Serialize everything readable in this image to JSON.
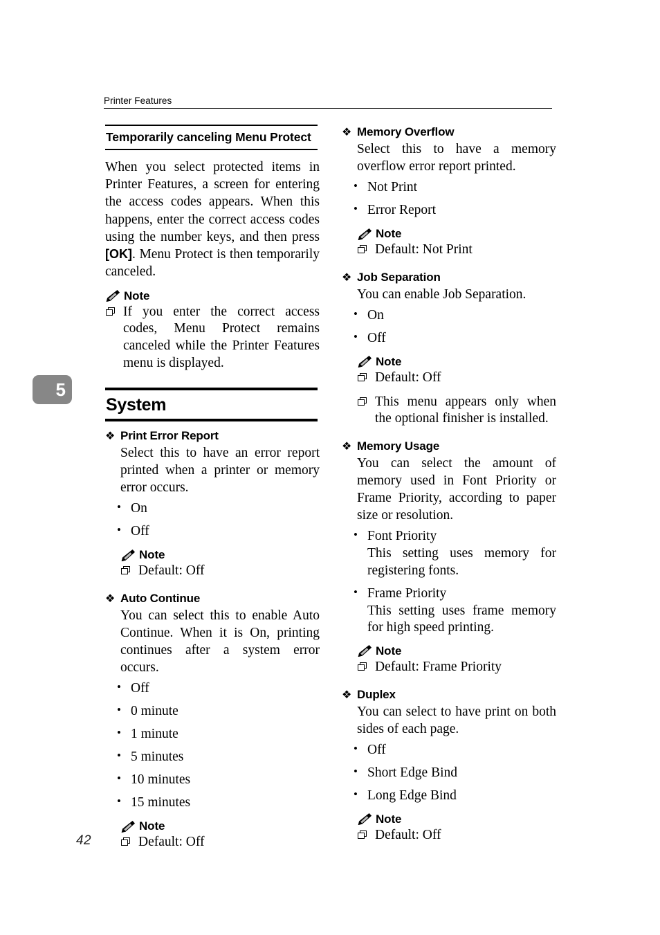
{
  "header": {
    "running_head": "Printer Features"
  },
  "chapter_tab": {
    "number": "5",
    "bg": "#878787",
    "fg": "#ffffff"
  },
  "folio": {
    "page_number": "42"
  },
  "left_column": {
    "subheading": "Temporarily canceling Menu Protect",
    "intro_paragraph": "When you select protected items in Printer Features, a screen for entering the access codes appears. When this happens, enter the correct access codes using the number keys, and then press [OK]. Menu Protect is then temporarily canceled.",
    "intro_paragraph_before_kbd": "When you select protected items in Printer Features, a screen for entering the access codes appears. When this happens, enter the correct access codes using the number keys, and then press ",
    "intro_paragraph_kbd": "[OK]",
    "intro_paragraph_after_kbd": ". Menu Protect is then temporarily canceled.",
    "note_label": "Note",
    "note_items": [
      "If you enter the correct access codes, Menu Protect remains canceled while the Printer Features menu is displayed."
    ],
    "big_heading": "System",
    "sections": [
      {
        "title": "Print Error Report",
        "body": "Select this to have an error report printed when a printer or memory error occurs.",
        "options": [
          "On",
          "Off"
        ],
        "note_label": "Note",
        "note_items": [
          "Default: Off"
        ]
      },
      {
        "title": "Auto Continue",
        "body": "You can select this to enable Auto Continue. When it is On, printing continues after a system error occurs.",
        "options": [
          "Off",
          "0 minute",
          "1 minute",
          "5 minutes",
          "10 minutes",
          "15 minutes"
        ],
        "note_label": "Note",
        "note_items": [
          "Default: Off"
        ]
      }
    ]
  },
  "right_column": {
    "sections": [
      {
        "title": "Memory Overflow",
        "body": "Select this to have a memory overflow error report printed.",
        "options": [
          "Not Print",
          "Error Report"
        ],
        "note_label": "Note",
        "note_items": [
          "Default: Not Print"
        ]
      },
      {
        "title": "Job Separation",
        "body": "You can enable Job Separation.",
        "options": [
          "On",
          "Off"
        ],
        "note_label": "Note",
        "note_items": [
          "Default: Off",
          "This menu appears only when the optional finisher is installed."
        ]
      },
      {
        "title": "Memory Usage",
        "body": "You can select the amount of memory used in Font Priority or Frame Priority, according to paper size or resolution.",
        "options": [
          "Font Priority",
          "Frame Priority"
        ],
        "option_descriptions": [
          "This setting uses memory for registering fonts.",
          "This setting uses frame memory for high speed printing."
        ],
        "note_label": "Note",
        "note_items": [
          "Default: Frame Priority"
        ]
      },
      {
        "title": "Duplex",
        "body": "You can select to have print on both sides of each page.",
        "options": [
          "Off",
          "Short Edge Bind",
          "Long Edge Bind"
        ],
        "note_label": "Note",
        "note_items": [
          "Default: Off"
        ]
      }
    ]
  },
  "icons": {
    "diamond": "❖",
    "square_bullet": "square-shadow",
    "pencil": "pencil"
  }
}
